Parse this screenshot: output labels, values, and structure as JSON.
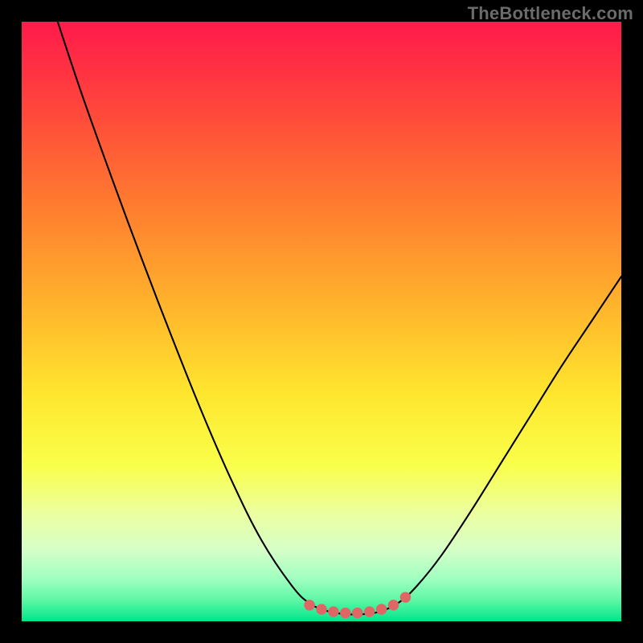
{
  "watermark": {
    "text": "TheBottleneck.com"
  },
  "colors": {
    "frame": "#000000",
    "curve": "#000000",
    "marker": "#e06666",
    "gradient_stops": [
      {
        "offset": 0.0,
        "color": "#ff1a4b"
      },
      {
        "offset": 0.12,
        "color": "#ff3e3e"
      },
      {
        "offset": 0.3,
        "color": "#ff7a2f"
      },
      {
        "offset": 0.48,
        "color": "#ffb62c"
      },
      {
        "offset": 0.62,
        "color": "#ffe62e"
      },
      {
        "offset": 0.74,
        "color": "#f9ff4a"
      },
      {
        "offset": 0.82,
        "color": "#ecffa0"
      },
      {
        "offset": 0.88,
        "color": "#d6ffc8"
      },
      {
        "offset": 0.93,
        "color": "#9fffc0"
      },
      {
        "offset": 0.965,
        "color": "#5cf7a5"
      },
      {
        "offset": 1.0,
        "color": "#00e58a"
      }
    ]
  },
  "chart_data": {
    "type": "line",
    "title": "",
    "xlabel": "",
    "ylabel": "",
    "xlim": [
      0,
      100
    ],
    "ylim": [
      0,
      100
    ],
    "grid": false,
    "legend": false,
    "curve_points": [
      {
        "x": 6.0,
        "y": 100.0
      },
      {
        "x": 10.0,
        "y": 88.0
      },
      {
        "x": 15.0,
        "y": 74.0
      },
      {
        "x": 20.0,
        "y": 60.5
      },
      {
        "x": 25.0,
        "y": 47.5
      },
      {
        "x": 30.0,
        "y": 35.0
      },
      {
        "x": 35.0,
        "y": 23.5
      },
      {
        "x": 40.0,
        "y": 13.5
      },
      {
        "x": 45.0,
        "y": 6.0
      },
      {
        "x": 48.0,
        "y": 3.0
      },
      {
        "x": 51.0,
        "y": 1.7
      },
      {
        "x": 54.0,
        "y": 1.2
      },
      {
        "x": 57.0,
        "y": 1.2
      },
      {
        "x": 60.0,
        "y": 1.7
      },
      {
        "x": 63.0,
        "y": 3.2
      },
      {
        "x": 66.0,
        "y": 6.0
      },
      {
        "x": 70.0,
        "y": 11.0
      },
      {
        "x": 75.0,
        "y": 18.5
      },
      {
        "x": 80.0,
        "y": 26.5
      },
      {
        "x": 85.0,
        "y": 34.5
      },
      {
        "x": 90.0,
        "y": 42.5
      },
      {
        "x": 95.0,
        "y": 50.0
      },
      {
        "x": 100.0,
        "y": 57.5
      }
    ],
    "markers": [
      {
        "x": 48.0,
        "y": 2.7
      },
      {
        "x": 50.0,
        "y": 2.0
      },
      {
        "x": 52.0,
        "y": 1.6
      },
      {
        "x": 54.0,
        "y": 1.4
      },
      {
        "x": 56.0,
        "y": 1.4
      },
      {
        "x": 58.0,
        "y": 1.6
      },
      {
        "x": 60.0,
        "y": 2.0
      },
      {
        "x": 62.0,
        "y": 2.7
      },
      {
        "x": 64.0,
        "y": 4.0
      }
    ],
    "marker_radius_pct": 0.9
  }
}
